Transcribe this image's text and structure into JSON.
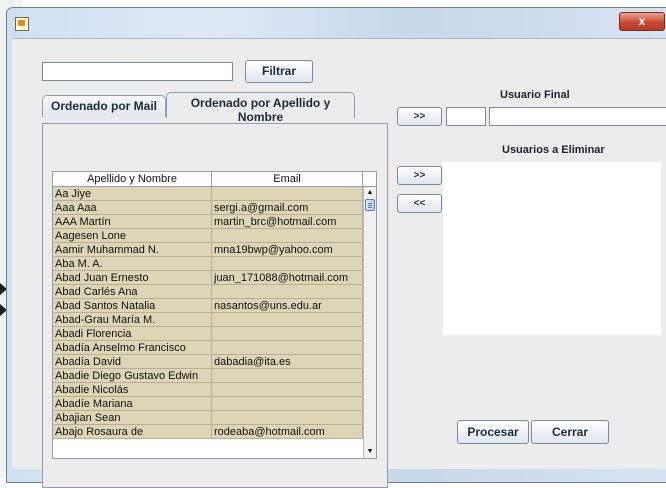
{
  "window": {
    "close_label": "x"
  },
  "filter": {
    "input_value": "",
    "button_label": "Filtrar"
  },
  "tabs": [
    {
      "label": "Ordenado por Mail"
    },
    {
      "label": "Ordenado por Apellido y Nombre"
    }
  ],
  "table": {
    "columns": [
      "Apellido y Nombre",
      "Email"
    ],
    "rows": [
      [
        "Aa Jiye",
        ""
      ],
      [
        "Aaa Aaa",
        "sergi.a@gmail.com"
      ],
      [
        "AAA Martín",
        "martin_brc@hotmail.com"
      ],
      [
        "Aagesen Lone",
        ""
      ],
      [
        "Aamir Muhammad N.",
        "mna19bwp@yahoo.com"
      ],
      [
        "Aba M. A.",
        ""
      ],
      [
        "Abad Juan Ernesto",
        "juan_171088@hotmail.com"
      ],
      [
        "Abad Carlés Ana",
        ""
      ],
      [
        "Abad Santos Natalia",
        "nasantos@uns.edu.ar"
      ],
      [
        "Abad-Grau María M.",
        ""
      ],
      [
        "Abadi Florencia",
        ""
      ],
      [
        "Abadía Anselmo Francisco",
        ""
      ],
      [
        "Abadía David",
        "dabadia@ita.es"
      ],
      [
        "Abadie Diego Gustavo Edwin",
        ""
      ],
      [
        "Abadie Nicolás",
        ""
      ],
      [
        "Abadíe Mariana",
        ""
      ],
      [
        "Abajian Sean",
        ""
      ],
      [
        "Abajo Rosaura de",
        "rodeaba@hotmail.com"
      ]
    ]
  },
  "usuario_final": {
    "label": "Usuario Final",
    "move_button": ">>",
    "id_value": "",
    "name_value": ""
  },
  "usuarios_eliminar": {
    "label": "Usuarios a Eliminar",
    "add_button": ">>",
    "remove_button": "<<",
    "items": []
  },
  "actions": {
    "process_label": "Procesar",
    "close_label": "Cerrar"
  }
}
